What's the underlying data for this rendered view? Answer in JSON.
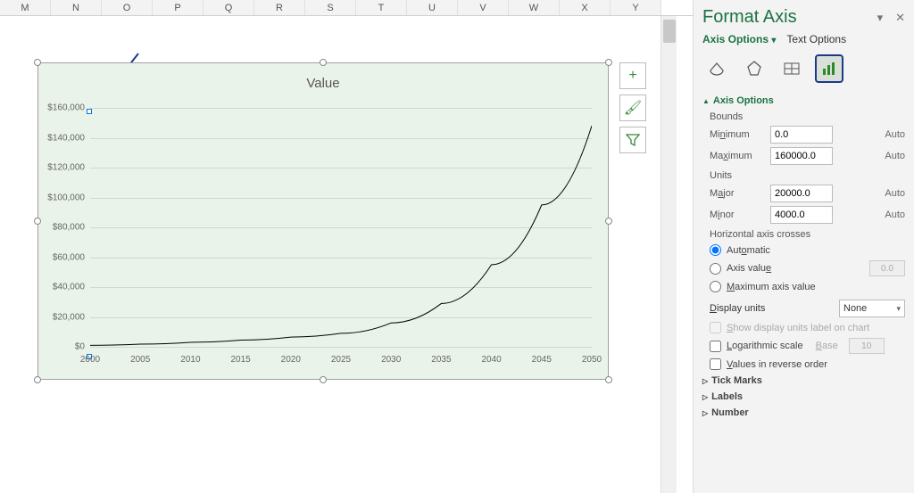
{
  "columns": [
    "M",
    "N",
    "O",
    "P",
    "Q",
    "R",
    "S",
    "T",
    "U",
    "V",
    "W",
    "X",
    "Y"
  ],
  "chart": {
    "title": "Value",
    "y_labels": [
      "$160,000",
      "$140,000",
      "$120,000",
      "$100,000",
      "$80,000",
      "$60,000",
      "$40,000",
      "$20,000",
      "$0"
    ],
    "x_labels": [
      "2000",
      "2005",
      "2010",
      "2015",
      "2020",
      "2025",
      "2030",
      "2035",
      "2040",
      "2045",
      "2050"
    ]
  },
  "chart_data": {
    "type": "line",
    "title": "Value",
    "xlabel": "",
    "ylabel": "",
    "xlim": [
      2000,
      2050
    ],
    "ylim": [
      0,
      160000
    ],
    "x_ticks": [
      2000,
      2005,
      2010,
      2015,
      2020,
      2025,
      2030,
      2035,
      2040,
      2045,
      2050
    ],
    "y_ticks": [
      0,
      20000,
      40000,
      60000,
      80000,
      100000,
      120000,
      140000,
      160000
    ],
    "series": [
      {
        "name": "Value",
        "x": [
          2000,
          2005,
          2010,
          2015,
          2020,
          2025,
          2030,
          2035,
          2040,
          2045,
          2050
        ],
        "y": [
          1000,
          1800,
          3000,
          4500,
          6500,
          9000,
          16000,
          29000,
          55000,
          95000,
          148000
        ]
      }
    ]
  },
  "panel": {
    "title": "Format Axis",
    "tab_axis": "Axis Options",
    "tab_text": "Text Options",
    "section_axis_options": "Axis Options",
    "bounds_label": "Bounds",
    "minimum_label": "Minimum",
    "minimum_value": "0.0",
    "maximum_label": "Maximum",
    "maximum_value": "160000.0",
    "units_label": "Units",
    "major_label": "Major",
    "major_value": "20000.0",
    "minor_label": "Minor",
    "minor_value": "4000.0",
    "auto_label": "Auto",
    "crosses_label": "Horizontal axis crosses",
    "radio_auto": "Automatic",
    "radio_axisvalue": "Axis value",
    "radio_axisvalue_val": "0.0",
    "radio_max": "Maximum axis value",
    "display_units_label": "Display units",
    "display_units_value": "None",
    "show_units_label": "Show display units label on chart",
    "log_label": "Logarithmic scale",
    "log_base_label": "Base",
    "log_base_value": "10",
    "reverse_label": "Values in reverse order",
    "section_tick": "Tick Marks",
    "section_labels": "Labels",
    "section_number": "Number"
  }
}
